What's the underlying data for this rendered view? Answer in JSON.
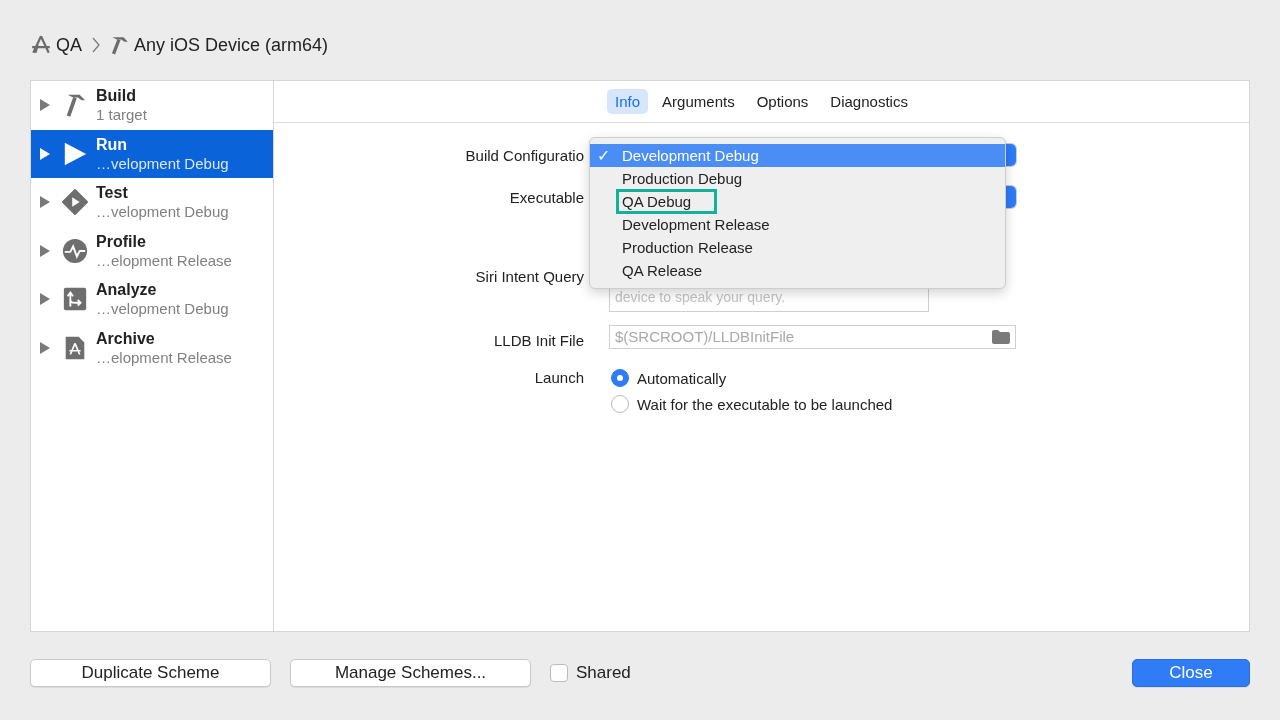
{
  "breadcrumb": {
    "scheme": "QA",
    "destination": "Any iOS Device (arm64)"
  },
  "sidebar": {
    "items": [
      {
        "kind": "build",
        "name": "Build",
        "subtitle": "1 target",
        "selected": false
      },
      {
        "kind": "run",
        "name": "Run",
        "subtitle": "…velopment Debug",
        "selected": true
      },
      {
        "kind": "test",
        "name": "Test",
        "subtitle": "…velopment Debug",
        "selected": false
      },
      {
        "kind": "profile",
        "name": "Profile",
        "subtitle": "…elopment Release",
        "selected": false
      },
      {
        "kind": "analyze",
        "name": "Analyze",
        "subtitle": "…velopment Debug",
        "selected": false
      },
      {
        "kind": "archive",
        "name": "Archive",
        "subtitle": "…elopment Release",
        "selected": false
      }
    ]
  },
  "tabs": [
    {
      "label": "Info",
      "selected": true
    },
    {
      "label": "Arguments",
      "selected": false
    },
    {
      "label": "Options",
      "selected": false
    },
    {
      "label": "Diagnostics",
      "selected": false
    }
  ],
  "form": {
    "build_configuration_label": "Build Configuratio",
    "executable_label": "Executable",
    "siri_label": "Siri Intent Query",
    "siri_placeholder": "device to speak your query.",
    "lldb_label": "LLDB Init File",
    "lldb_placeholder": "$(SRCROOT)/LLDBInitFile",
    "launch_label": "Launch",
    "launch_options": [
      {
        "label": "Automatically",
        "selected": true
      },
      {
        "label": "Wait for the executable to be launched",
        "selected": false
      }
    ]
  },
  "menu": {
    "items": [
      {
        "label": "Development Debug",
        "selected": true,
        "outlined": false
      },
      {
        "label": "Production Debug",
        "selected": false,
        "outlined": false
      },
      {
        "label": "QA Debug",
        "selected": false,
        "outlined": true
      },
      {
        "label": "Development Release",
        "selected": false,
        "outlined": false
      },
      {
        "label": "Production Release",
        "selected": false,
        "outlined": false
      },
      {
        "label": "QA Release",
        "selected": false,
        "outlined": false
      }
    ],
    "check": "✓"
  },
  "footer": {
    "duplicate": "Duplicate Scheme",
    "manage": "Manage Schemes...",
    "shared": {
      "label": "Shared",
      "checked": false
    },
    "close": "Close"
  }
}
